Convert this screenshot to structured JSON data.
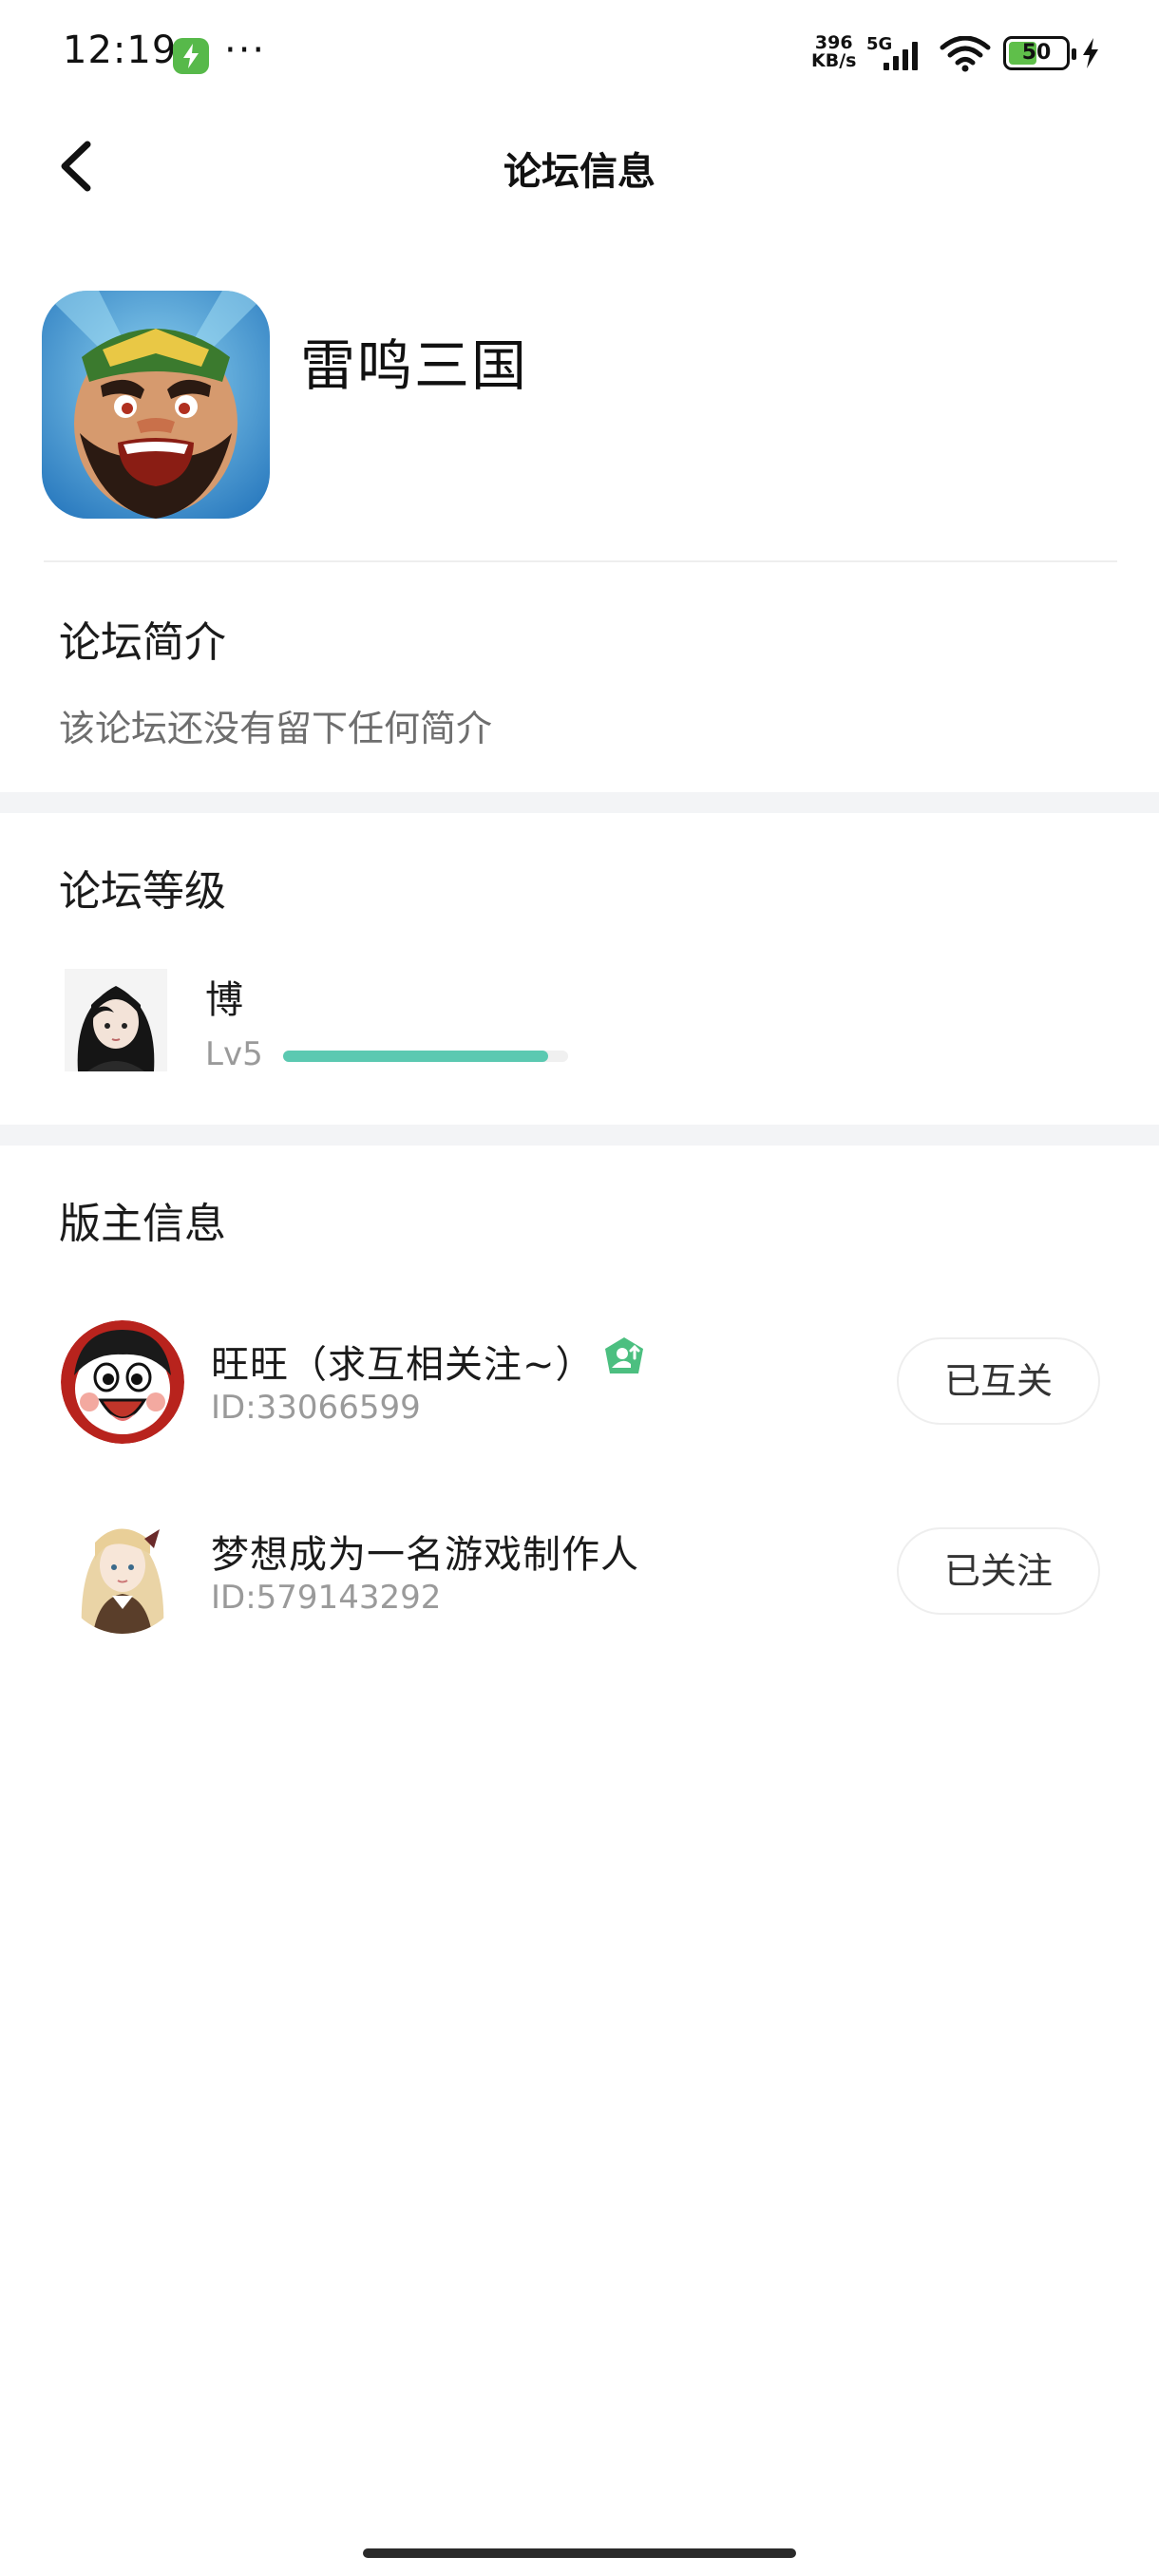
{
  "status_bar": {
    "time": "12:19",
    "dots": "···",
    "network_speed_value": "396",
    "network_speed_unit": "KB/s",
    "network_type": "5G",
    "battery_level": "50"
  },
  "header": {
    "title": "论坛信息"
  },
  "forum": {
    "name": "雷鸣三国"
  },
  "intro": {
    "section_title": "论坛简介",
    "text": "该论坛还没有留下任何简介"
  },
  "level": {
    "section_title": "论坛等级",
    "user_name": "博",
    "level_label": "Lv5",
    "progress": 0.93
  },
  "moderators": {
    "section_title": "版主信息",
    "items": [
      {
        "name": "旺旺（求互相关注~）",
        "id": "ID:33066599",
        "follow_label": "已互关"
      },
      {
        "name": "梦想成为一名游戏制作人",
        "id": "ID:579143292",
        "follow_label": "已关注"
      }
    ]
  },
  "colors": {
    "accent": "#5bc9b1",
    "badge": "#4cbf80",
    "divider": "#f3f4f6"
  }
}
